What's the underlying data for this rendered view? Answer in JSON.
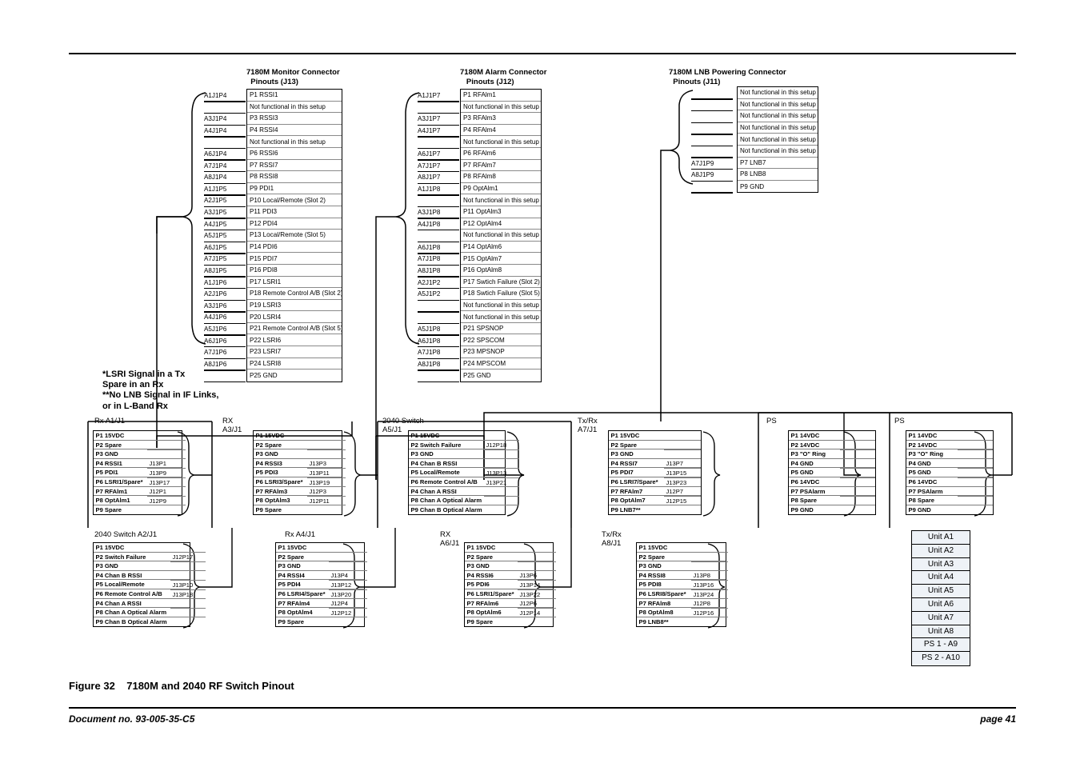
{
  "figure": {
    "caption": "Figure 32    7180M and 2040 RF Switch Pinout",
    "document_no": "Document no. 93-005-35-C5",
    "page_no": "page 41"
  },
  "notes": {
    "text": "*LSRI Signal in a Tx\nSpare in an Rx\n**No LNB Signal in IF Links,\nor in L-Band Rx"
  },
  "monitor_connector": {
    "title": "7180M Monitor Connector\n  Pinouts (J13)",
    "rows": [
      {
        "ref": "A1J1P4",
        "pin": "P1 RSSI1"
      },
      {
        "ref": "",
        "pin": "Not functional in this setup"
      },
      {
        "ref": "A3J1P4",
        "pin": "P3 RSSI3"
      },
      {
        "ref": "A4J1P4",
        "pin": "P4 RSSI4"
      },
      {
        "ref": "",
        "pin": "Not functional in this setup"
      },
      {
        "ref": "A6J1P4",
        "pin": "P6 RSSI6"
      },
      {
        "ref": "A7J1P4",
        "pin": "P7 RSSI7"
      },
      {
        "ref": "A8J1P4",
        "pin": "P8 RSSI8"
      },
      {
        "ref": "A1J1P5",
        "pin": "P9 PDI1"
      },
      {
        "ref": "A2J1P5",
        "pin": "P10 Local/Remote (Slot 2)"
      },
      {
        "ref": "A3J1P5",
        "pin": "P11 PDI3"
      },
      {
        "ref": "A4J1P5",
        "pin": "P12 PDI4"
      },
      {
        "ref": "A5J1P5",
        "pin": "P13 Local/Remote (Slot 5)"
      },
      {
        "ref": "A6J1P5",
        "pin": "P14 PDI6"
      },
      {
        "ref": "A7J1P5",
        "pin": "P15 PDI7"
      },
      {
        "ref": "A8J1P5",
        "pin": "P16 PDI8"
      },
      {
        "ref": "A1J1P6",
        "pin": "P17 LSRI1"
      },
      {
        "ref": "A2J1P6",
        "pin": "P18 Remote Control A/B (Slot 2)"
      },
      {
        "ref": "A3J1P6",
        "pin": "P19 LSRI3"
      },
      {
        "ref": "A4J1P6",
        "pin": "P20 LSRI4"
      },
      {
        "ref": "A5J1P6",
        "pin": "P21 Remote Control A/B (Slot 5)"
      },
      {
        "ref": "A6J1P6",
        "pin": "P22 LSRI6"
      },
      {
        "ref": "A7J1P6",
        "pin": "P23 LSRI7"
      },
      {
        "ref": "A8J1P6",
        "pin": "P24 LSRI8"
      },
      {
        "ref": "",
        "pin": "P25 GND"
      }
    ]
  },
  "alarm_connector": {
    "title": "7180M Alarm Connector\n   Pinouts (J12)",
    "rows": [
      {
        "ref": "A1J1P7",
        "pin": "P1 RFAlm1"
      },
      {
        "ref": "",
        "pin": "Not functional in this setup"
      },
      {
        "ref": "A3J1P7",
        "pin": "P3 RFAlm3"
      },
      {
        "ref": "A4J1P7",
        "pin": "P4 RFAlm4"
      },
      {
        "ref": "",
        "pin": "Not functional in this setup"
      },
      {
        "ref": "A6J1P7",
        "pin": "P6 RFAlm6"
      },
      {
        "ref": "A7J1P7",
        "pin": "P7 RFAlm7"
      },
      {
        "ref": "A8J1P7",
        "pin": "P8 RFAlm8"
      },
      {
        "ref": "A1J1P8",
        "pin": "P9 OptAlm1"
      },
      {
        "ref": "",
        "pin": "Not functional in this setup"
      },
      {
        "ref": "A3J1P8",
        "pin": "P11 OptAlm3"
      },
      {
        "ref": "A4J1P8",
        "pin": "P12 OptAlm4"
      },
      {
        "ref": "",
        "pin": "Not functional in this setup"
      },
      {
        "ref": "A6J1P8",
        "pin": "P14 OptAlm6"
      },
      {
        "ref": "A7J1P8",
        "pin": "P15 OptAlm7"
      },
      {
        "ref": "A8J1P8",
        "pin": "P16 OptAlm8"
      },
      {
        "ref": "A2J1P2",
        "pin": "P17 Swtich Failure (Slot 2)"
      },
      {
        "ref": "A5J1P2",
        "pin": "P18 Swtich Failure (Slot 5)"
      },
      {
        "ref": "",
        "pin": "Not functional in this setup"
      },
      {
        "ref": "",
        "pin": "Not functional in this setup"
      },
      {
        "ref": "A5J1P8",
        "pin": "P21 SPSNOP"
      },
      {
        "ref": "A6J1P8",
        "pin": "P22 SPSCOM"
      },
      {
        "ref": "A7J1P8",
        "pin": "P23 MPSNOP"
      },
      {
        "ref": "A8J1P8",
        "pin": "P24 MPSCOM"
      },
      {
        "ref": "",
        "pin": "P25 GND"
      }
    ]
  },
  "lnb_connector": {
    "title": "7180M LNB Powering Connector\n  Pinouts (J11)",
    "rows": [
      {
        "ref": "",
        "pin": "Not functional in this setup"
      },
      {
        "ref": "",
        "pin": "Not functional in this setup"
      },
      {
        "ref": "",
        "pin": "Not functional in this setup"
      },
      {
        "ref": "",
        "pin": "Not functional in this setup"
      },
      {
        "ref": "",
        "pin": "Not functional in this setup"
      },
      {
        "ref": "",
        "pin": "Not functional in this setup"
      },
      {
        "ref": "A7J1P9",
        "pin": "P7 LNB7"
      },
      {
        "ref": "A8J1P9",
        "pin": "P8 LNB8"
      },
      {
        "ref": "",
        "pin": "P9 GND"
      }
    ]
  },
  "connectors": [
    {
      "id": "rx-a1-j1",
      "label": "Rx A1/J1",
      "label_lines": [
        "Rx A1/J1"
      ],
      "rows": [
        {
          "pin": "P1 15VDC",
          "ref": ""
        },
        {
          "pin": "P2 Spare",
          "ref": ""
        },
        {
          "pin": "P3 GND",
          "ref": ""
        },
        {
          "pin": "P4 RSSI1",
          "ref": "J13P1"
        },
        {
          "pin": "P5 PDI1",
          "ref": "J13P9"
        },
        {
          "pin": "P6 LSRI1/Spare*",
          "ref": "J13P17"
        },
        {
          "pin": "P7 RFAlm1",
          "ref": "J12P1"
        },
        {
          "pin": "P8 OptAlm1",
          "ref": "J12P9"
        },
        {
          "pin": "P9 Spare",
          "ref": ""
        }
      ]
    },
    {
      "id": "rx-a3-j1",
      "label": "RX A3/J1",
      "label_lines": [
        "RX",
        "A3/J1"
      ],
      "rows": [
        {
          "pin": "P1 15VDC",
          "ref": ""
        },
        {
          "pin": "P2 Spare",
          "ref": ""
        },
        {
          "pin": "P3 GND",
          "ref": ""
        },
        {
          "pin": "P4 RSSI3",
          "ref": "J13P3"
        },
        {
          "pin": "P5 PDI3",
          "ref": "J13P11"
        },
        {
          "pin": "P6 LSRI3/Spare*",
          "ref": "J13P19"
        },
        {
          "pin": "P7 RFAlm3",
          "ref": "J12P3"
        },
        {
          "pin": "P8 OptAlm3",
          "ref": "J12P11"
        },
        {
          "pin": "P9 Spare",
          "ref": ""
        }
      ]
    },
    {
      "id": "switch-a5-j1",
      "label": "2040 Switch A5/J1",
      "label_lines": [
        "2040 Switch",
        "A5/J1"
      ],
      "rows": [
        {
          "pin": "P1 15VDC",
          "ref": ""
        },
        {
          "pin": "P2 Switch Failure",
          "ref": "J12P18"
        },
        {
          "pin": "P3 GND",
          "ref": ""
        },
        {
          "pin": "P4 Chan B RSSI",
          "ref": ""
        },
        {
          "pin": "P5 Local/Remote",
          "ref": "J13P13"
        },
        {
          "pin": "P6 Remote Control A/B",
          "ref": "J13P21"
        },
        {
          "pin": "P4 Chan A RSSI",
          "ref": ""
        },
        {
          "pin": "P8 Chan A Optical Alarm",
          "ref": ""
        },
        {
          "pin": "P9 Chan B Optical Alarm",
          "ref": ""
        }
      ]
    },
    {
      "id": "txrx-a7-j1",
      "label": "Tx/Rx A7/J1",
      "label_lines": [
        "Tx/Rx",
        "A7/J1"
      ],
      "rows": [
        {
          "pin": "P1 15VDC",
          "ref": ""
        },
        {
          "pin": "P2 Spare",
          "ref": ""
        },
        {
          "pin": "P3 GND",
          "ref": ""
        },
        {
          "pin": "P4 RSSI7",
          "ref": "J13P7"
        },
        {
          "pin": "P5 PDI7",
          "ref": "J13P15"
        },
        {
          "pin": "P6 LSRI7/Spare*",
          "ref": "J13P23"
        },
        {
          "pin": "P7 RFAlm7",
          "ref": "J12P7"
        },
        {
          "pin": "P8 OptAlm7",
          "ref": "J12P15"
        },
        {
          "pin": "P9 LNB7**",
          "ref": ""
        }
      ]
    },
    {
      "id": "ps-1",
      "label": "PS",
      "label_lines": [
        "PS"
      ],
      "rows": [
        {
          "pin": "P1 14VDC",
          "ref": ""
        },
        {
          "pin": "P2 14VDC",
          "ref": ""
        },
        {
          "pin": "P3 \"O\" Ring",
          "ref": ""
        },
        {
          "pin": "P4 GND",
          "ref": ""
        },
        {
          "pin": "P5 GND",
          "ref": ""
        },
        {
          "pin": "P6 14VDC",
          "ref": ""
        },
        {
          "pin": "P7 PSAlarm",
          "ref": ""
        },
        {
          "pin": "P8 Spare",
          "ref": ""
        },
        {
          "pin": "P9 GND",
          "ref": ""
        }
      ]
    },
    {
      "id": "ps-2",
      "label": "PS",
      "label_lines": [
        "PS"
      ],
      "rows": [
        {
          "pin": "P1 14VDC",
          "ref": ""
        },
        {
          "pin": "P2 14VDC",
          "ref": ""
        },
        {
          "pin": "P3 \"O\" Ring",
          "ref": ""
        },
        {
          "pin": "P4 GND",
          "ref": ""
        },
        {
          "pin": "P5 GND",
          "ref": ""
        },
        {
          "pin": "P6 14VDC",
          "ref": ""
        },
        {
          "pin": "P7 PSAlarm",
          "ref": ""
        },
        {
          "pin": "P8 Spare",
          "ref": ""
        },
        {
          "pin": "P9 GND",
          "ref": ""
        }
      ]
    },
    {
      "id": "switch-a2-j1",
      "label": "2040 Switch A2/J1",
      "label_lines": [
        "2040 Switch A2/J1"
      ],
      "rows": [
        {
          "pin": "P1 15VDC",
          "ref": ""
        },
        {
          "pin": "P2 Switch Failure",
          "ref": "J12P17"
        },
        {
          "pin": "P3 GND",
          "ref": ""
        },
        {
          "pin": "P4 Chan B RSSI",
          "ref": ""
        },
        {
          "pin": "P5 Local/Remote",
          "ref": "J13P10"
        },
        {
          "pin": "P6 Remote Control A/B",
          "ref": "J13P18"
        },
        {
          "pin": "P4 Chan A RSSI",
          "ref": ""
        },
        {
          "pin": "P8 Chan A Optical Alarm",
          "ref": ""
        },
        {
          "pin": "P9 Chan B Optical Alarm",
          "ref": ""
        }
      ]
    },
    {
      "id": "rx-a4-j1",
      "label": "Rx A4/J1",
      "label_lines": [
        "Rx A4/J1"
      ],
      "rows": [
        {
          "pin": "P1 15VDC",
          "ref": ""
        },
        {
          "pin": "P2 Spare",
          "ref": ""
        },
        {
          "pin": "P3 GND",
          "ref": ""
        },
        {
          "pin": "P4 RSSI4",
          "ref": "J13P4"
        },
        {
          "pin": "P5 PDI4",
          "ref": "J13P12"
        },
        {
          "pin": "P6 LSRI4/Spare*",
          "ref": "J13P20"
        },
        {
          "pin": "P7 RFAlm4",
          "ref": "J12P4"
        },
        {
          "pin": "P8 OptAlm4",
          "ref": "J12P12"
        },
        {
          "pin": "P9 Spare",
          "ref": ""
        }
      ]
    },
    {
      "id": "rx-a6-j1",
      "label": "RX A6/J1",
      "label_lines": [
        "RX",
        "A6/J1"
      ],
      "rows": [
        {
          "pin": "P1 15VDC",
          "ref": ""
        },
        {
          "pin": "P2 Spare",
          "ref": ""
        },
        {
          "pin": "P3 GND",
          "ref": ""
        },
        {
          "pin": "P4 RSSI6",
          "ref": "J13P6"
        },
        {
          "pin": "P5 PDI6",
          "ref": "J13P14"
        },
        {
          "pin": "P6 LSRI1/Spare*",
          "ref": "J13P22"
        },
        {
          "pin": "P7 RFAlm6",
          "ref": "J12P6"
        },
        {
          "pin": "P8 OptAlm6",
          "ref": "J12P14"
        },
        {
          "pin": "P9 Spare",
          "ref": ""
        }
      ]
    },
    {
      "id": "txrx-a8-j1",
      "label": "Tx/Rx A8/J1",
      "label_lines": [
        "Tx/Rx",
        "A8/J1"
      ],
      "rows": [
        {
          "pin": "P1 15VDC",
          "ref": ""
        },
        {
          "pin": "P2 Spare",
          "ref": ""
        },
        {
          "pin": "P3 GND",
          "ref": ""
        },
        {
          "pin": "P4 RSSI8",
          "ref": "J13P8"
        },
        {
          "pin": "P5 PDI8",
          "ref": "J13P16"
        },
        {
          "pin": "P6 LSRI8/Spare*",
          "ref": "J13P24"
        },
        {
          "pin": "P7 RFAlm8",
          "ref": "J12P8"
        },
        {
          "pin": "P8 OptAlm8",
          "ref": "J12P16"
        },
        {
          "pin": "P9 LNB8**",
          "ref": ""
        }
      ]
    }
  ],
  "unit_legend": {
    "items": [
      "Unit A1",
      "Unit A2",
      "Unit A3",
      "Unit A4",
      "Unit A5",
      "Unit A6",
      "Unit A7",
      "Unit A8",
      "PS 1 - A9",
      "PS 2 - A10"
    ]
  }
}
